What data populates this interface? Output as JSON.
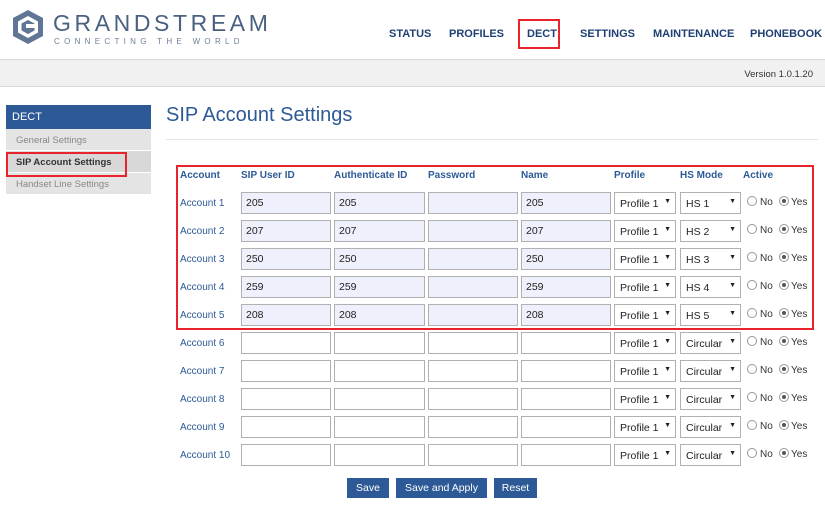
{
  "brand": {
    "name": "GRANDSTREAM",
    "tagline": "CONNECTING THE WORLD"
  },
  "nav": [
    "STATUS",
    "PROFILES",
    "DECT",
    "SETTINGS",
    "MAINTENANCE",
    "PHONEBOOK"
  ],
  "version": "Version 1.0.1.20",
  "sidebar": {
    "heading": "DECT",
    "items": [
      "General Settings",
      "SIP Account Settings",
      "Handset Line Settings"
    ],
    "active_index": 1
  },
  "page_title": "SIP Account Settings",
  "table": {
    "headers": [
      "Account",
      "SIP User ID",
      "Authenticate ID",
      "Password",
      "Name",
      "Profile",
      "HS Mode",
      "Active"
    ],
    "radio_labels": {
      "no": "No",
      "yes": "Yes"
    },
    "rows": [
      {
        "account": "Account 1",
        "sip_user_id": "205",
        "auth_id": "205",
        "password": "",
        "name": "205",
        "profile": "Profile 1",
        "hs_mode": "HS 1",
        "active": "Yes"
      },
      {
        "account": "Account 2",
        "sip_user_id": "207",
        "auth_id": "207",
        "password": "",
        "name": "207",
        "profile": "Profile 1",
        "hs_mode": "HS 2",
        "active": "Yes"
      },
      {
        "account": "Account 3",
        "sip_user_id": "250",
        "auth_id": "250",
        "password": "",
        "name": "250",
        "profile": "Profile 1",
        "hs_mode": "HS 3",
        "active": "Yes"
      },
      {
        "account": "Account 4",
        "sip_user_id": "259",
        "auth_id": "259",
        "password": "",
        "name": "259",
        "profile": "Profile 1",
        "hs_mode": "HS 4",
        "active": "Yes"
      },
      {
        "account": "Account 5",
        "sip_user_id": "208",
        "auth_id": "208",
        "password": "",
        "name": "208",
        "profile": "Profile 1",
        "hs_mode": "HS 5",
        "active": "Yes"
      },
      {
        "account": "Account 6",
        "sip_user_id": "",
        "auth_id": "",
        "password": "",
        "name": "",
        "profile": "Profile 1",
        "hs_mode": "Circular",
        "active": "Yes"
      },
      {
        "account": "Account 7",
        "sip_user_id": "",
        "auth_id": "",
        "password": "",
        "name": "",
        "profile": "Profile 1",
        "hs_mode": "Circular",
        "active": "Yes"
      },
      {
        "account": "Account 8",
        "sip_user_id": "",
        "auth_id": "",
        "password": "",
        "name": "",
        "profile": "Profile 1",
        "hs_mode": "Circular",
        "active": "Yes"
      },
      {
        "account": "Account 9",
        "sip_user_id": "",
        "auth_id": "",
        "password": "",
        "name": "",
        "profile": "Profile 1",
        "hs_mode": "Circular",
        "active": "Yes"
      },
      {
        "account": "Account 10",
        "sip_user_id": "",
        "auth_id": "",
        "password": "",
        "name": "",
        "profile": "Profile 1",
        "hs_mode": "Circular",
        "active": "Yes"
      }
    ]
  },
  "buttons": {
    "save": "Save",
    "save_apply": "Save and Apply",
    "reset": "Reset"
  },
  "colors": {
    "accent": "#2d5a96",
    "highlight": "#e8232b",
    "filled_field": "#eef0fb"
  }
}
